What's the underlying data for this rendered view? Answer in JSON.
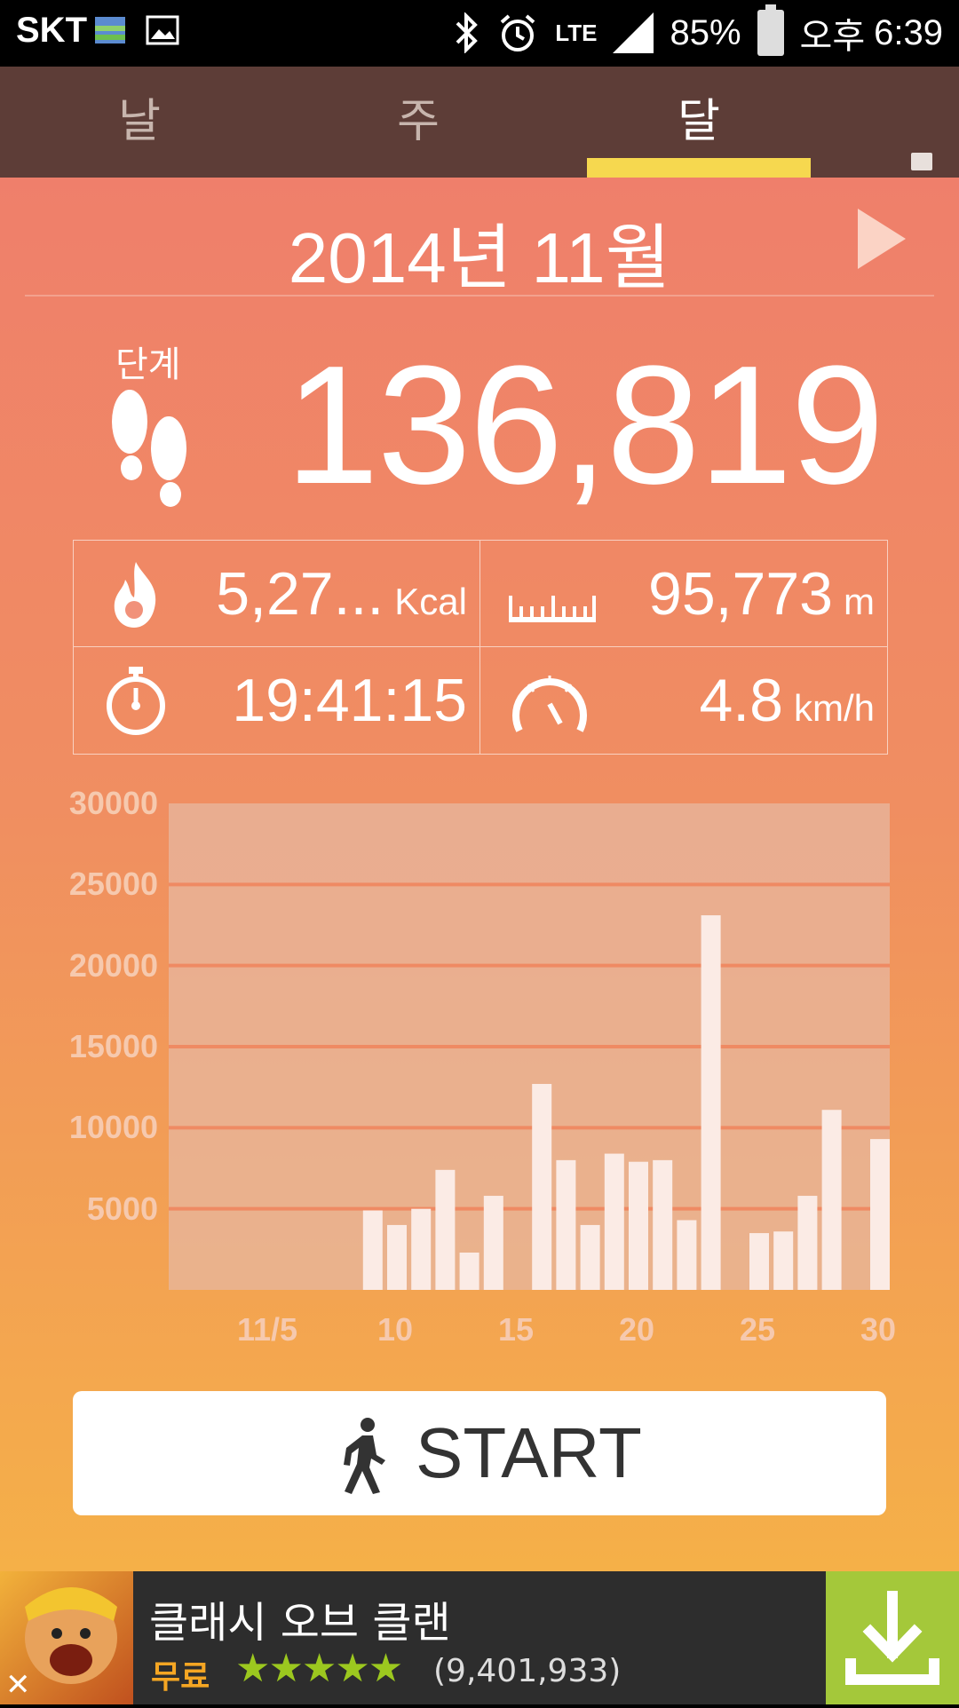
{
  "status_bar": {
    "carrier": "SKT",
    "battery": "85%",
    "ampm": "오후",
    "time": "6:39",
    "network": "LTE"
  },
  "tabs": [
    {
      "label": "날",
      "active": false
    },
    {
      "label": "주",
      "active": false
    },
    {
      "label": "달",
      "active": true
    }
  ],
  "header": {
    "month": "2014년 11월"
  },
  "steps": {
    "label": "단계",
    "value": "136,819"
  },
  "stats": {
    "calories": {
      "value": "5,27...",
      "unit": "Kcal"
    },
    "distance": {
      "value": "95,773",
      "unit": "m"
    },
    "duration": {
      "value": "19:41:15",
      "unit": ""
    },
    "speed": {
      "value": "4.8",
      "unit": "km/h"
    }
  },
  "chart_data": {
    "type": "bar",
    "ylim": [
      0,
      30000
    ],
    "yticks": [
      "30000",
      "25000",
      "20000",
      "15000",
      "10000",
      "5000"
    ],
    "xticks": [
      "11/5",
      "10",
      "15",
      "20",
      "25",
      "30"
    ],
    "x": [
      9,
      10,
      11,
      12,
      13,
      14,
      16,
      17,
      18,
      19,
      20,
      21,
      22,
      23,
      25,
      26,
      27,
      28,
      30
    ],
    "values": [
      4900,
      4000,
      5000,
      7400,
      2300,
      5800,
      12700,
      8000,
      4000,
      8400,
      7900,
      8000,
      4300,
      23100,
      3500,
      3600,
      5800,
      11100,
      9300
    ],
    "grid": true
  },
  "start_button": {
    "label": "START"
  },
  "ad": {
    "title": "클래시 오브 클랜",
    "price": "무료",
    "rating_stars": "★★★★★",
    "count": "(9,401,933)"
  },
  "colors": {
    "tab_bar": "#5d3d37",
    "tab_indicator": "#f6d84f",
    "bar": "#fbebe5",
    "download": "#a4c83a"
  }
}
